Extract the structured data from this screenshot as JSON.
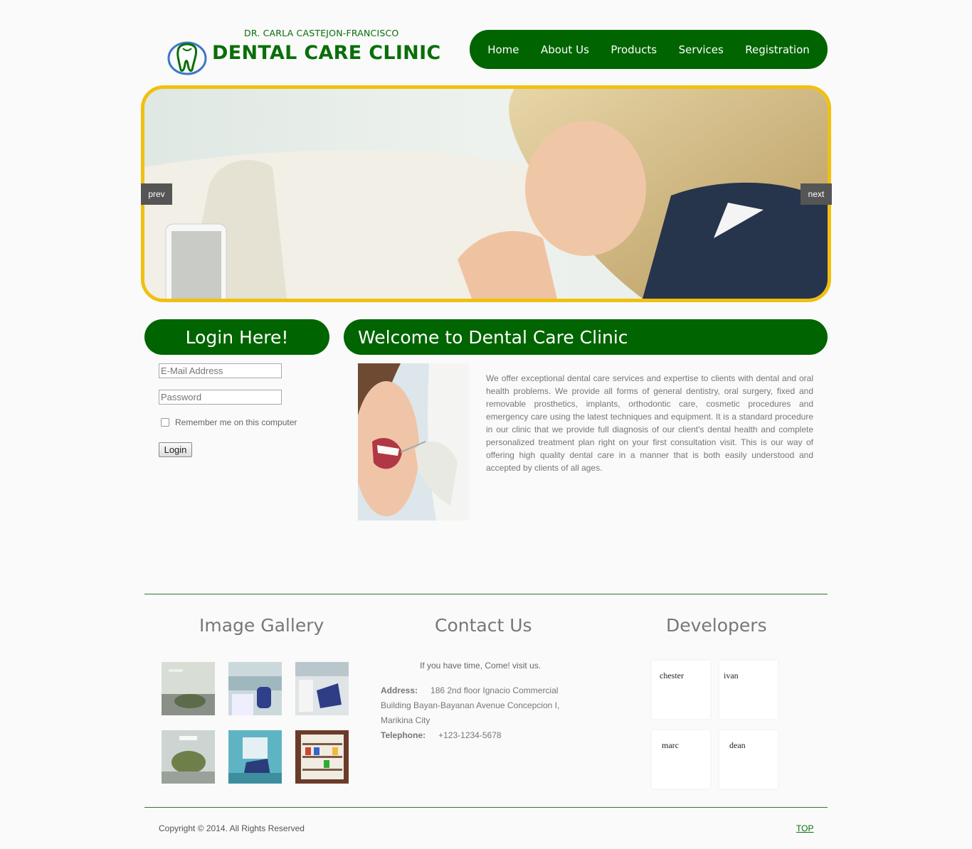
{
  "header": {
    "doctor_name": "DR. CARLA CASTEJON-FRANCISCO",
    "clinic_name": "DENTAL CARE CLINIC",
    "logo_icon": "tooth-icon"
  },
  "nav": {
    "items": [
      {
        "label": "Home"
      },
      {
        "label": "About Us"
      },
      {
        "label": "Products"
      },
      {
        "label": "Services"
      },
      {
        "label": "Registration"
      }
    ]
  },
  "slider": {
    "prev_label": "prev",
    "next_label": "next"
  },
  "login": {
    "title": "Login Here!",
    "email_placeholder": "E-Mail Address",
    "password_placeholder": "Password",
    "remember_label": "Remember me on this computer",
    "button_label": "Login"
  },
  "welcome": {
    "title": "Welcome to Dental Care Clinic",
    "body": "We offer exceptional dental care services and expertise to clients with dental and oral health problems. We provide all forms of general dentistry, oral surgery, fixed and removable prosthetics, implants, orthodontic care, cosmetic procedures and emergency care using the latest techniques and equipment. It is a standard procedure in our clinic that we provide full diagnosis of our client's dental health and complete personalized treatment plan right on your first consultation visit. This is our way of offering high quality dental care in a manner that is both easily understood and accepted by clients of all ages."
  },
  "gallery": {
    "title": "Image Gallery"
  },
  "contact": {
    "title": "Contact Us",
    "intro": "If you have time, Come! visit us.",
    "address_label": "Address:",
    "address": "186 2nd floor Ignacio Commercial Building Bayan-Bayanan Avenue Concepcion I, Marikina City",
    "phone_label": "Telephone:",
    "phone": "+123-1234-5678"
  },
  "developers": {
    "title": "Developers",
    "names": [
      "chester",
      "ivan",
      "marc",
      "dean"
    ]
  },
  "footer": {
    "copyright": "Copyright © 2014. All Rights Reserved",
    "top_link": "TOP"
  },
  "colors": {
    "brand_green": "#006400",
    "slider_border": "#f0c010"
  }
}
